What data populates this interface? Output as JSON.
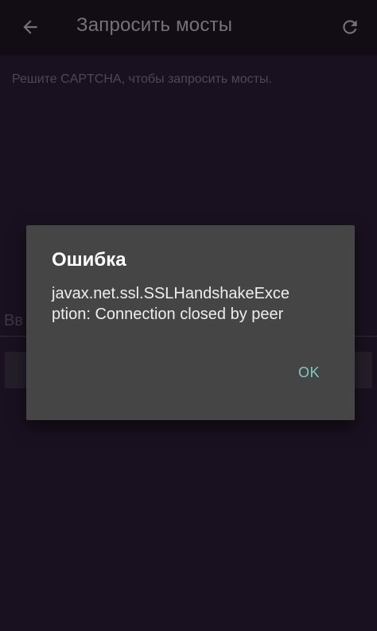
{
  "appbar": {
    "title": "Запросить мосты",
    "back_icon": "arrow-left-icon",
    "refresh_icon": "refresh-icon"
  },
  "main": {
    "instructions": "Решите CAPTCHA, чтобы запросить мосты.",
    "captcha_input_visible_text": "Вв"
  },
  "dialog": {
    "title": "Ошибка",
    "message": "javax.net.ssl.SSLHandshakeException: Connection closed by peer",
    "ok_label": "OK"
  },
  "colors": {
    "background": "#1f1526",
    "appbar": "#161119",
    "dialog": "#454545",
    "accent": "#7fcbc4"
  }
}
